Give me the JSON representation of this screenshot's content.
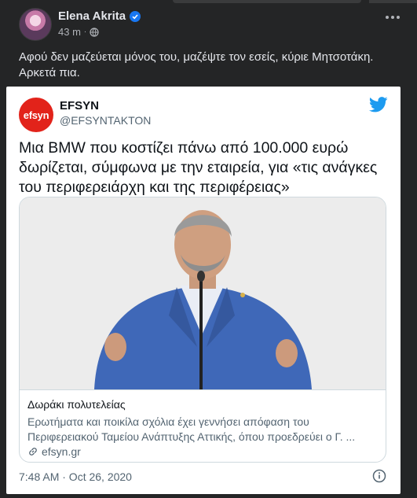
{
  "post": {
    "author": "Elena Akrita",
    "time": "43 m",
    "privacy_icon": "globe-icon",
    "text": "Αφού δεν μαζεύεται μόνος του, μαζέψτε τον εσείς, κύριε Μητσοτάκη. Αρκετά πια."
  },
  "tweet": {
    "logo_text": "efsyn",
    "name": "EFSYN",
    "handle": "@EFSYNTAKTON",
    "body": "Μια BMW που κοστίζει πάνω από 100.000 ευρώ δωρίζεται, σύμφωνα με την εταιρεία, για «τις ανάγκες του περιφερειάρχη και της περιφέρειας»",
    "link_card": {
      "title": "Δωράκι πολυτελείας",
      "description": "Ερωτήματα και ποικίλα σχόλια έχει γεννήσει απόφαση του Περιφερειακού Ταμείου Ανάπτυξης Αττικής, όπου προεδρεύει ο Γ. ...",
      "domain": "efsyn.gr"
    },
    "timestamp": "7:48 AM · Oct 26, 2020"
  },
  "colors": {
    "background": "#242526",
    "verified": "#1877f2",
    "efsyn_red": "#e2231a",
    "twitter_blue": "#1d9bf0"
  }
}
